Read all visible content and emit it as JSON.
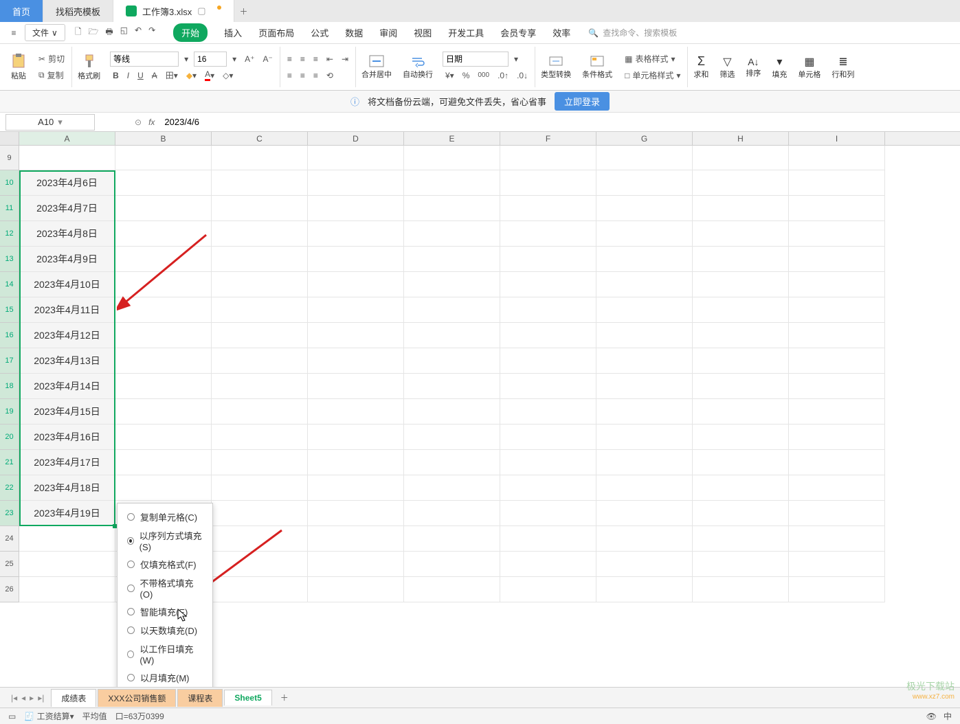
{
  "tabs": {
    "home": "首页",
    "doke": "找稻壳模板",
    "doc": "工作簿3.xlsx"
  },
  "file_btn": "文件",
  "menu": {
    "start": "开始",
    "insert": "插入",
    "layout": "页面布局",
    "formula": "公式",
    "data": "数据",
    "review": "审阅",
    "view": "视图",
    "dev": "开发工具",
    "member": "会员专享",
    "efficiency": "效率"
  },
  "search_placeholder": "查找命令、搜索模板",
  "ribbon": {
    "paste": "粘贴",
    "cut": "剪切",
    "copy": "复制",
    "format_painter": "格式刷",
    "font_name": "等线",
    "font_size": "16",
    "merge": "合并居中",
    "wrap": "自动换行",
    "number_format": "日期",
    "type_convert": "类型转换",
    "cond_fmt": "条件格式",
    "table_style": "表格样式",
    "cell_style": "单元格样式",
    "sum": "求和",
    "filter": "筛选",
    "sort": "排序",
    "fill": "填充",
    "cell": "单元格",
    "row_col": "行和列"
  },
  "notif": {
    "text": "将文档备份云端，可避免文件丢失，省心省事",
    "login": "立即登录"
  },
  "name_box": "A10",
  "formula_value": "2023/4/6",
  "columns": [
    "A",
    "B",
    "C",
    "D",
    "E",
    "F",
    "G",
    "H",
    "I"
  ],
  "row_start": 9,
  "dates": [
    "2023年4月6日",
    "2023年4月7日",
    "2023年4月8日",
    "2023年4月9日",
    "2023年4月10日",
    "2023年4月11日",
    "2023年4月12日",
    "2023年4月13日",
    "2023年4月14日",
    "2023年4月15日",
    "2023年4月16日",
    "2023年4月17日",
    "2023年4月18日",
    "2023年4月19日"
  ],
  "context_menu": [
    {
      "label": "复制单元格(C)",
      "checked": false
    },
    {
      "label": "以序列方式填充(S)",
      "checked": true
    },
    {
      "label": "仅填充格式(F)",
      "checked": false
    },
    {
      "label": "不带格式填充(O)",
      "checked": false
    },
    {
      "label": "智能填充(E)",
      "checked": false
    },
    {
      "label": "以天数填充(D)",
      "checked": false
    },
    {
      "label": "以工作日填充(W)",
      "checked": false
    },
    {
      "label": "以月填充(M)",
      "checked": false
    }
  ],
  "sheets": {
    "s1": "成绩表",
    "s2": "XXX公司销售额",
    "s3": "课程表",
    "s4": "Sheet5"
  },
  "status": {
    "salary": "工资结算",
    "avg": "平均值",
    "sum_val": "口=63万0399"
  },
  "watermark": {
    "line1": "极光下载站",
    "line2": "www.xz7.com"
  },
  "icons": {
    "hamburger": "≡",
    "save": "🖫",
    "print": "🖶",
    "preview": "◱",
    "undo": "↶",
    "redo": "↷",
    "scissors": "✂",
    "copy": "⧉",
    "brush": "🖌",
    "chevron": "▾",
    "search": "🔍",
    "bold": "B",
    "italic": "I",
    "underline": "U",
    "strike": "S",
    "border": "田",
    "fillcolor": "◆",
    "fontcolor": "A",
    "align_top": "≡",
    "align_mid": "≡",
    "align_bot": "≡",
    "align_left": "≡",
    "align_center": "≡",
    "align_right": "≡",
    "indent_dec": "⇤",
    "indent_inc": "⇥",
    "merge": "⬌",
    "wrap": "↵",
    "currency": "¥",
    "percent": "%",
    "comma": "000",
    "dec_inc": ".0▲",
    "dec_dec": ".0▼",
    "convert": "↔",
    "cond": "▦",
    "table": "▦",
    "cell_style": "□",
    "sigma": "Σ",
    "filter": "▽",
    "sort": "A↓",
    "fill": "▼",
    "cell_ico": "▦",
    "rows": "≣",
    "eye": "👁",
    "info": "ⓘ",
    "grid": "▦",
    "input_mode": "中"
  },
  "colors": {
    "accent": "#0fa85f",
    "link": "#4a90e2",
    "arrow": "#d62020"
  }
}
